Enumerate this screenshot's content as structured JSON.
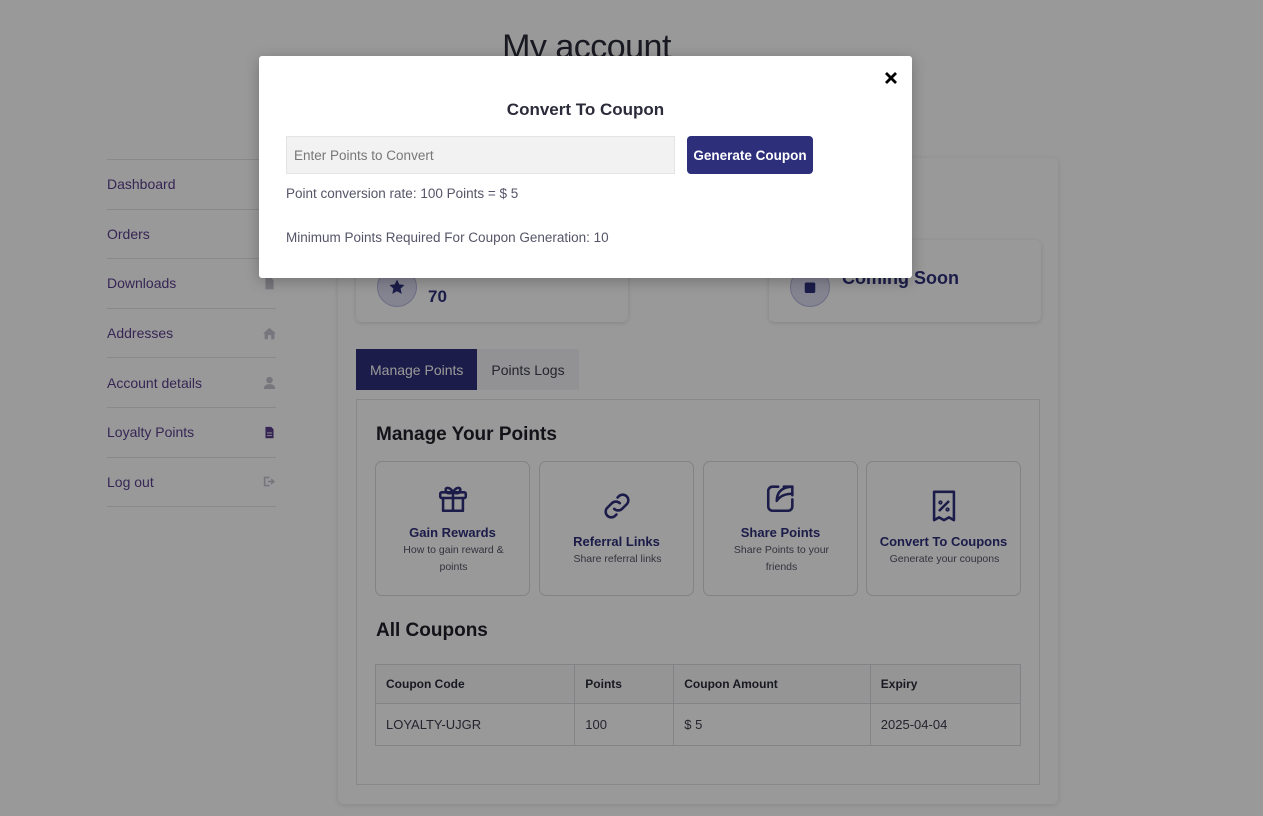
{
  "page": {
    "title": "My account"
  },
  "sidebar": {
    "items": [
      {
        "label": "Dashboard",
        "icon": "dashboard-icon"
      },
      {
        "label": "Orders",
        "icon": "cart-icon"
      },
      {
        "label": "Downloads",
        "icon": "file-icon"
      },
      {
        "label": "Addresses",
        "icon": "home-icon"
      },
      {
        "label": "Account details",
        "icon": "user-icon"
      },
      {
        "label": "Loyalty Points",
        "icon": "document-icon",
        "active": true
      },
      {
        "label": "Log out",
        "icon": "logout-icon"
      }
    ]
  },
  "stats": {
    "points_value": "70",
    "coming_soon": "Coming Soon"
  },
  "tabs": {
    "manage": "Manage Points",
    "logs": "Points Logs"
  },
  "manage": {
    "title": "Manage Your Points",
    "cards": [
      {
        "title": "Gain Rewards",
        "desc": "How to gain reward & points",
        "icon": "gift-icon"
      },
      {
        "title": "Referral Links",
        "desc": "Share referral links",
        "icon": "link-icon"
      },
      {
        "title": "Share Points",
        "desc": "Share Points to your friends",
        "icon": "share-icon"
      },
      {
        "title": "Convert To Coupons",
        "desc": "Generate your coupons",
        "icon": "coupon-icon"
      }
    ]
  },
  "coupons": {
    "title": "All Coupons",
    "headers": [
      "Coupon Code",
      "Points",
      "Coupon Amount",
      "Expiry"
    ],
    "rows": [
      [
        "LOYALTY-UJGR",
        "100",
        "$ 5",
        "2025-04-04"
      ]
    ]
  },
  "modal": {
    "title": "Convert To Coupon",
    "input_placeholder": "Enter Points to Convert",
    "button_label": "Generate Coupon",
    "rate_text": "Point conversion rate: 100 Points = $ 5",
    "minimum_text": "Minimum Points Required For Coupon Generation: 10"
  },
  "colors": {
    "accent": "#2d2f7a",
    "nav_link": "#5b3f8c",
    "overlay": "rgba(0,0,0,0.4)"
  }
}
